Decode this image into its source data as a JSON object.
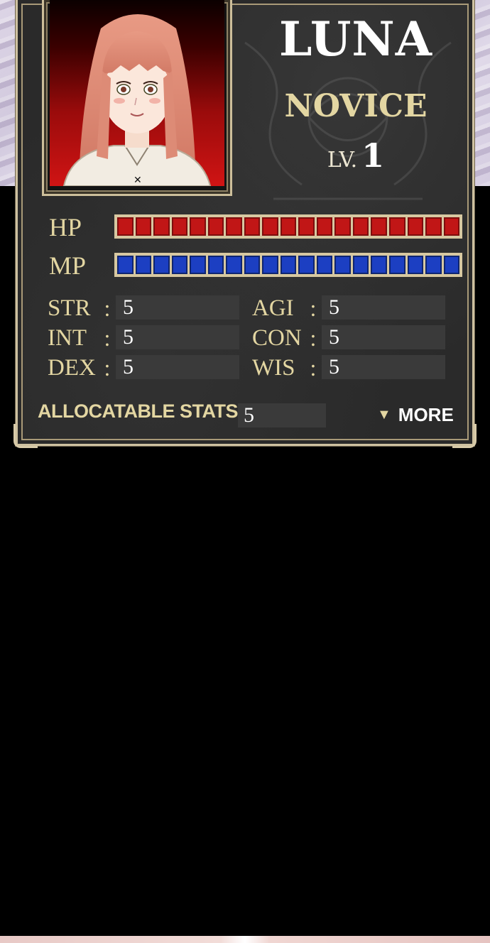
{
  "character": {
    "name": "LUNA",
    "job": "NOVICE",
    "level_label": "LV.",
    "level": "1"
  },
  "bars": {
    "hp_label": "HP",
    "mp_label": "MP",
    "hp_fill": 1.0,
    "mp_fill": 1.0,
    "hp_color": "#c11616",
    "mp_color": "#1c3fc2"
  },
  "stats": {
    "colon": ":",
    "str_label": "STR",
    "str": "5",
    "agi_label": "AGI",
    "agi": "5",
    "int_label": "INT",
    "int": "5",
    "con_label": "CON",
    "con": "5",
    "dex_label": "DEX",
    "dex": "5",
    "wis_label": "WIS",
    "wis": "5"
  },
  "allocatable": {
    "label": "ALLOCATABLE STATS:",
    "value": "5"
  },
  "more": {
    "icon": "triangle-down-icon",
    "label": "MORE"
  },
  "colors": {
    "frame_gold": "#cfc1a0",
    "label_gold": "#e3d6a2",
    "panel_bg": "#2a2a2a"
  }
}
